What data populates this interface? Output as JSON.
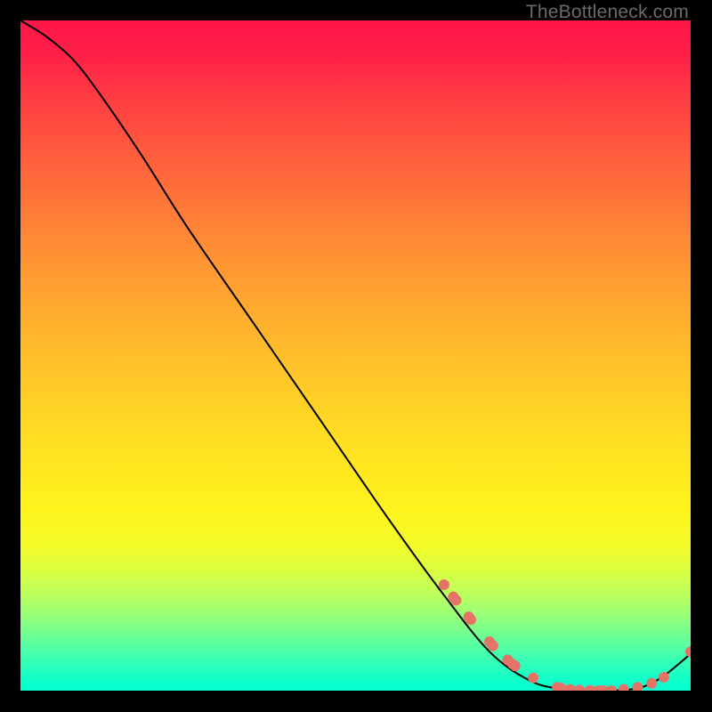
{
  "watermark": "TheBottleneck.com",
  "chart_data": {
    "type": "line",
    "title": "",
    "xlabel": "",
    "ylabel": "",
    "series": [
      {
        "name": "curve",
        "x": [
          0,
          0.04,
          0.08,
          0.12,
          0.18,
          0.25,
          0.35,
          0.45,
          0.55,
          0.63,
          0.7,
          0.76,
          0.81,
          0.86,
          0.9,
          0.93,
          0.96,
          1.0
        ],
        "y": [
          1.0,
          0.975,
          0.94,
          0.888,
          0.8,
          0.69,
          0.545,
          0.4,
          0.255,
          0.145,
          0.058,
          0.015,
          0.002,
          0.0,
          0.001,
          0.006,
          0.022,
          0.055
        ],
        "stroke": "#000000",
        "stroke_width": 2
      },
      {
        "name": "dots",
        "type": "scatter",
        "points": [
          {
            "x": 0.632,
            "y": 0.158
          },
          {
            "x": 0.646,
            "y": 0.14
          },
          {
            "x": 0.65,
            "y": 0.135
          },
          {
            "x": 0.669,
            "y": 0.11
          },
          {
            "x": 0.672,
            "y": 0.106
          },
          {
            "x": 0.7,
            "y": 0.073
          },
          {
            "x": 0.705,
            "y": 0.067
          },
          {
            "x": 0.727,
            "y": 0.046
          },
          {
            "x": 0.734,
            "y": 0.04
          },
          {
            "x": 0.738,
            "y": 0.037
          },
          {
            "x": 0.765,
            "y": 0.019
          },
          {
            "x": 0.801,
            "y": 0.005
          },
          {
            "x": 0.806,
            "y": 0.004
          },
          {
            "x": 0.82,
            "y": 0.002
          },
          {
            "x": 0.834,
            "y": 0.001
          },
          {
            "x": 0.849,
            "y": 0.0
          },
          {
            "x": 0.852,
            "y": 0.0
          },
          {
            "x": 0.863,
            "y": 0.0
          },
          {
            "x": 0.87,
            "y": 0.0
          },
          {
            "x": 0.882,
            "y": 0.0
          },
          {
            "x": 0.9,
            "y": 0.002
          },
          {
            "x": 0.921,
            "y": 0.005
          },
          {
            "x": 0.942,
            "y": 0.011
          },
          {
            "x": 0.96,
            "y": 0.02
          },
          {
            "x": 1.0,
            "y": 0.058
          }
        ],
        "color": "#e57368",
        "radius": 6
      }
    ],
    "xlim": [
      0,
      1
    ],
    "ylim": [
      0,
      1
    ]
  }
}
